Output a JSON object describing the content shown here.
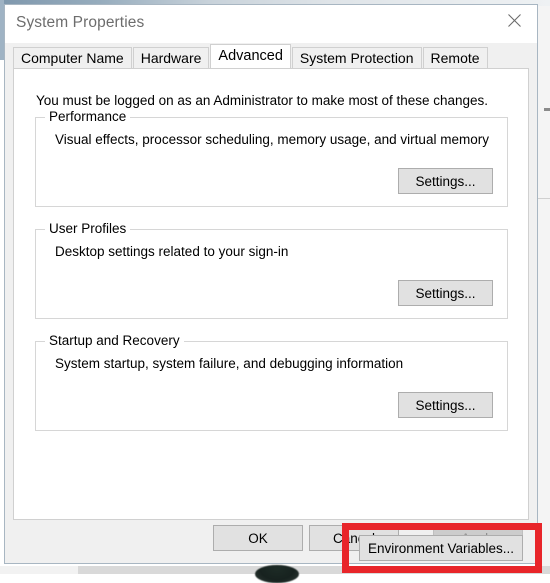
{
  "window": {
    "title": "System Properties",
    "close_icon": "close-icon"
  },
  "tabs": [
    {
      "label": "Computer Name",
      "selected": false
    },
    {
      "label": "Hardware",
      "selected": false
    },
    {
      "label": "Advanced",
      "selected": true
    },
    {
      "label": "System Protection",
      "selected": false
    },
    {
      "label": "Remote",
      "selected": false
    }
  ],
  "panel": {
    "admin_note": "You must be logged on as an Administrator to make most of these changes.",
    "groups": [
      {
        "legend": "Performance",
        "description": "Visual effects, processor scheduling, memory usage, and virtual memory",
        "button": "Settings..."
      },
      {
        "legend": "User Profiles",
        "description": "Desktop settings related to your sign-in",
        "button": "Settings..."
      },
      {
        "legend": "Startup and Recovery",
        "description": "System startup, system failure, and debugging information",
        "button": "Settings..."
      }
    ],
    "environment_variables_button": "Environment Variables...",
    "highlight_color": "#e8252a"
  },
  "actions": {
    "ok": "OK",
    "cancel": "Cancel",
    "apply": "Apply",
    "apply_enabled": false
  }
}
